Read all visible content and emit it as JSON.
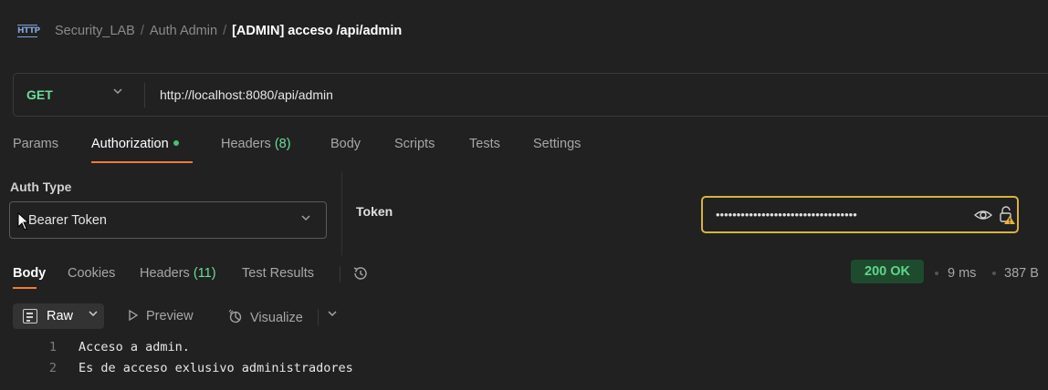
{
  "header": {
    "protocol_icon": "HTTP",
    "breadcrumb": [
      "Security_LAB",
      "Auth Admin"
    ],
    "separator": "/",
    "request_name": "[ADMIN] acceso /api/admin"
  },
  "request": {
    "method": "GET",
    "url": "http://localhost:8080/api/admin",
    "method_color": "#6bdd9a"
  },
  "request_tabs": {
    "params": "Params",
    "authorization": "Authorization",
    "headers": "Headers",
    "headers_count": "(8)",
    "body": "Body",
    "scripts": "Scripts",
    "tests": "Tests",
    "settings": "Settings"
  },
  "auth": {
    "type_label": "Auth Type",
    "type_value": "Bearer Token",
    "token_label": "Token",
    "token_masked": "••••••••••••••••••••••••••••••••••",
    "accent_color": "#d8b341"
  },
  "response_tabs": {
    "body": "Body",
    "cookies": "Cookies",
    "headers": "Headers",
    "headers_count": "(11)",
    "test_results": "Test Results"
  },
  "response_meta": {
    "status": "200 OK",
    "time": "9 ms",
    "size": "387 B"
  },
  "response_toolbar": {
    "format": "Raw",
    "preview": "Preview",
    "visualize": "Visualize"
  },
  "response_body": {
    "lines": [
      {
        "number": "1",
        "text": "Acceso a admin."
      },
      {
        "number": "2",
        "text": "Es de acceso exlusivo administradores"
      }
    ]
  },
  "colors": {
    "background": "#212121",
    "active_tab_underline": "#f27b35",
    "status_green": "#5fd68a",
    "status_badge_bg": "#1e4a2e"
  }
}
